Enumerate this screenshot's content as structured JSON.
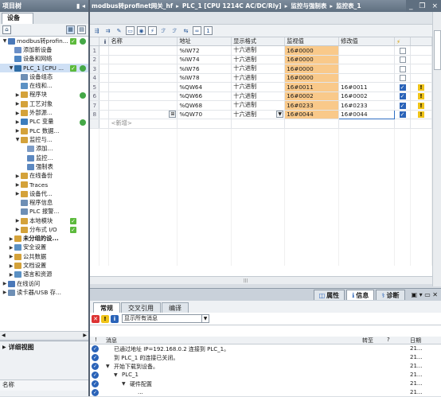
{
  "project_panel": {
    "title": "项目树",
    "tab": "设备",
    "tree": [
      {
        "indent": 0,
        "tw": "▼",
        "label": "modbus转profin...",
        "icon_color": "#4a78b8",
        "check": true,
        "dot": true
      },
      {
        "indent": 1,
        "tw": "",
        "label": "添加新设备",
        "icon_color": "#6b8fc7"
      },
      {
        "indent": 1,
        "tw": "",
        "label": "设备和网络",
        "icon_color": "#4e85c2"
      },
      {
        "indent": 1,
        "tw": "▼",
        "label": "PLC_1 [CPU ...",
        "icon_color": "#2f6da5",
        "check": true,
        "dot": true
      },
      {
        "indent": 2,
        "tw": "",
        "label": "设备组态",
        "icon_color": "#6e8fb5"
      },
      {
        "indent": 2,
        "tw": "",
        "label": "在线和...",
        "icon_color": "#5b91c4"
      },
      {
        "indent": 2,
        "tw": "▶",
        "label": "程序块",
        "icon_color": "#d4a23a",
        "dot": true
      },
      {
        "indent": 2,
        "tw": "▶",
        "label": "工艺对象",
        "icon_color": "#d4a23a"
      },
      {
        "indent": 2,
        "tw": "▶",
        "label": "外部源...",
        "icon_color": "#d4a23a"
      },
      {
        "indent": 2,
        "tw": "▶",
        "label": "PLC 变量",
        "icon_color": "#3c7dbd",
        "dot": true
      },
      {
        "indent": 2,
        "tw": "▶",
        "label": "PLC 数据...",
        "icon_color": "#d4a23a"
      },
      {
        "indent": 2,
        "tw": "▼",
        "label": "监控与...",
        "icon_color": "#d4a23a"
      },
      {
        "indent": 3,
        "tw": "",
        "label": "添加...",
        "icon_color": "#7d9cc6"
      },
      {
        "indent": 3,
        "tw": "",
        "label": "监控...",
        "icon_color": "#5c88c0"
      },
      {
        "indent": 3,
        "tw": "",
        "label": "强制表",
        "icon_color": "#5c88c0"
      },
      {
        "indent": 2,
        "tw": "▶",
        "label": "在线备份",
        "icon_color": "#d4a23a"
      },
      {
        "indent": 2,
        "tw": "▶",
        "label": "Traces",
        "icon_color": "#d4a23a"
      },
      {
        "indent": 2,
        "tw": "▶",
        "label": "设备代...",
        "icon_color": "#d4a23a"
      },
      {
        "indent": 2,
        "tw": "",
        "label": "程序信息",
        "icon_color": "#6e8fb5"
      },
      {
        "indent": 2,
        "tw": "",
        "label": "PLC 报警...",
        "icon_color": "#6e8fb5"
      },
      {
        "indent": 2,
        "tw": "▶",
        "label": "本地模块",
        "icon_color": "#d4a23a",
        "check": true
      },
      {
        "indent": 2,
        "tw": "▶",
        "label": "分布式 I/O",
        "icon_color": "#d4a23a",
        "check": true
      },
      {
        "indent": 1,
        "tw": "▶",
        "label": "未分组的设...",
        "icon_color": "#d4a23a",
        "bold": true
      },
      {
        "indent": 1,
        "tw": "▶",
        "label": "安全设置",
        "icon_color": "#5b91c4"
      },
      {
        "indent": 1,
        "tw": "▶",
        "label": "公共数据",
        "icon_color": "#d4a23a"
      },
      {
        "indent": 1,
        "tw": "▶",
        "label": "文档设置",
        "icon_color": "#d4a23a"
      },
      {
        "indent": 1,
        "tw": "▶",
        "label": "语言和资源",
        "icon_color": "#5b91c4"
      },
      {
        "indent": 0,
        "tw": "▶",
        "label": "在线访问",
        "icon_color": "#4a78b8"
      },
      {
        "indent": 0,
        "tw": "▶",
        "label": "读卡器/USB 存...",
        "icon_color": "#6e8fb5"
      }
    ],
    "detail_view_title": "详细视图",
    "detail_name_col": "名称"
  },
  "breadcrumb": [
    "modbus转profinet网关_hf",
    "PLC_1 [CPU 1214C AC/DC/Rly]",
    "监控与强制表",
    "监控表_1"
  ],
  "breadcrumb_sep": "▸",
  "window_controls": [
    "_",
    "❐",
    "×"
  ],
  "watch_table": {
    "headers": {
      "icon": "i",
      "name": "名称",
      "address": "地址",
      "format": "显示格式",
      "monitor": "监视值",
      "modify": "修改值",
      "flag": "⚡"
    },
    "rows": [
      {
        "n": "1",
        "address": "%IW72",
        "format": "十六进制",
        "monitor": "16#0000",
        "modify": "",
        "checked": false,
        "warn": false
      },
      {
        "n": "2",
        "address": "%IW74",
        "format": "十六进制",
        "monitor": "16#0000",
        "modify": "",
        "checked": false,
        "warn": false
      },
      {
        "n": "3",
        "address": "%IW76",
        "format": "十六进制",
        "monitor": "16#0000",
        "modify": "",
        "checked": false,
        "warn": false
      },
      {
        "n": "4",
        "address": "%IW78",
        "format": "十六进制",
        "monitor": "16#0000",
        "modify": "",
        "checked": false,
        "warn": false
      },
      {
        "n": "5",
        "address": "%QW64",
        "format": "十六进制",
        "monitor": "16#0011",
        "modify": "16#0011",
        "checked": true,
        "warn": true
      },
      {
        "n": "6",
        "address": "%QW66",
        "format": "十六进制",
        "monitor": "16#0002",
        "modify": "16#0002",
        "checked": true,
        "warn": true
      },
      {
        "n": "7",
        "address": "%QW68",
        "format": "十六进制",
        "monitor": "16#0233",
        "modify": "16#0233",
        "checked": true,
        "warn": true
      },
      {
        "n": "8",
        "address": "%QW70",
        "format": "十六进制",
        "monitor": "16#0044",
        "modify": "16#0044",
        "checked": true,
        "warn": true,
        "editing": true
      }
    ],
    "new_row": "<新增>"
  },
  "inspector": {
    "tabs": [
      "属性",
      "信息",
      "诊断"
    ],
    "subtabs": [
      "常规",
      "交叉引用",
      "编译"
    ],
    "filter_value": "显示所有消息",
    "columns": {
      "bang": "!",
      "message": "消息",
      "goto": "转至",
      "q": "?",
      "date": "日期"
    },
    "messages": [
      {
        "indent": 0,
        "arrow": "",
        "text": "已通过地址 IP=192.168.0.2 连接到 PLC_1。",
        "date": "21..."
      },
      {
        "indent": 0,
        "arrow": "",
        "text": "到 PLC_1 的连接已关闭。",
        "date": "21..."
      },
      {
        "indent": 0,
        "arrow": "▼",
        "text": "开始下载到设备。",
        "date": "21..."
      },
      {
        "indent": 1,
        "arrow": "▼",
        "text": "PLC_1",
        "date": "21..."
      },
      {
        "indent": 2,
        "arrow": "▼",
        "text": "硬件配置",
        "date": "21..."
      },
      {
        "indent": 3,
        "arrow": "",
        "text": "...",
        "date": "21..."
      }
    ]
  }
}
